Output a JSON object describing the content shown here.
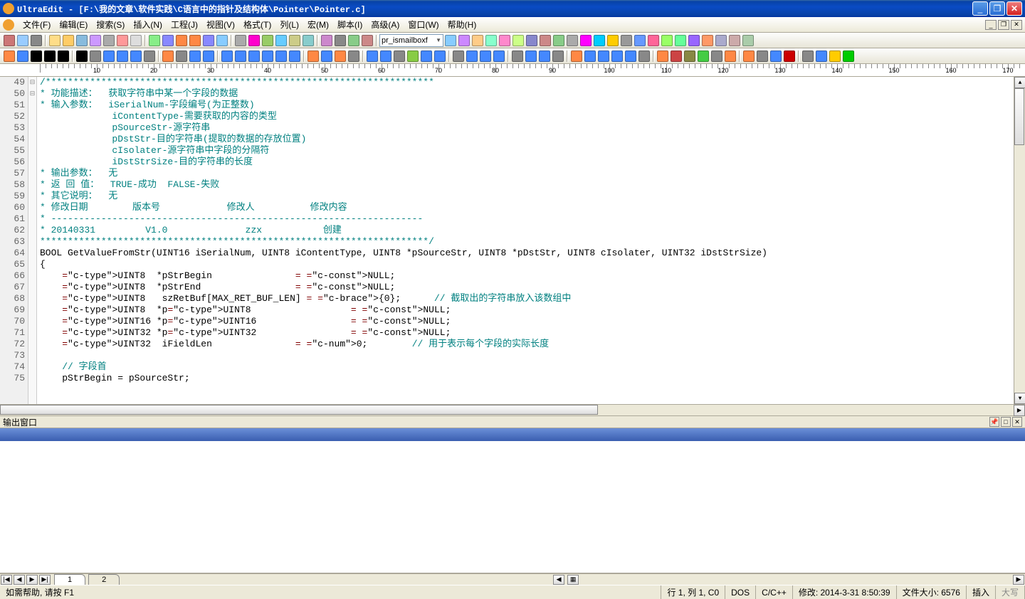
{
  "title": "UltraEdit - [F:\\我的文章\\软件实践\\C语言中的指针及结构体\\Pointer\\Pointer.c]",
  "menus": [
    "文件(F)",
    "编辑(E)",
    "搜索(S)",
    "插入(N)",
    "工程(J)",
    "视图(V)",
    "格式(T)",
    "列(L)",
    "宏(M)",
    "脚本(I)",
    "高级(A)",
    "窗口(W)",
    "帮助(H)"
  ],
  "toolbar_combo": "pr_ismailboxf",
  "ruler_marks": [
    10,
    20,
    30,
    40,
    50,
    60,
    70,
    80,
    90,
    100,
    110,
    120,
    130,
    140,
    150,
    160,
    170
  ],
  "gutter_start": 49,
  "code_lines": [
    {
      "t": "comment",
      "text": "/**********************************************************************"
    },
    {
      "t": "comment",
      "text": "* 功能描述：  获取字符串中某一个字段的数据"
    },
    {
      "t": "comment",
      "text": "* 输入参数：  iSerialNum-字段编号(为正整数)"
    },
    {
      "t": "comment",
      "text": "             iContentType-需要获取的内容的类型"
    },
    {
      "t": "comment",
      "text": "             pSourceStr-源字符串"
    },
    {
      "t": "comment",
      "text": "             pDstStr-目的字符串(提取的数据的存放位置)"
    },
    {
      "t": "comment",
      "text": "             cIsolater-源字符串中字段的分隔符"
    },
    {
      "t": "comment",
      "text": "             iDstStrSize-目的字符串的长度"
    },
    {
      "t": "comment",
      "text": "* 输出参数：  无"
    },
    {
      "t": "comment",
      "text": "* 返 回 值：  TRUE-成功  FALSE-失败"
    },
    {
      "t": "comment",
      "text": "* 其它说明：  无"
    },
    {
      "t": "comment",
      "text": "* 修改日期        版本号            修改人          修改内容"
    },
    {
      "t": "comment",
      "text": "* -------------------------------------------------------------------"
    },
    {
      "t": "comment",
      "text": "* 20140331         V1.0              zzx           创建"
    },
    {
      "t": "comment",
      "text": "**********************************************************************/"
    },
    {
      "t": "sig",
      "text": "BOOL GetValueFromStr(UINT16 iSerialNum, UINT8 iContentType, UINT8 *pSourceStr, UINT8 *pDstStr, UINT8 cIsolater, UINT32 iDstStrSize)"
    },
    {
      "t": "brace",
      "text": "{"
    },
    {
      "t": "decl",
      "text": "    UINT8  *pStrBegin               = NULL;"
    },
    {
      "t": "decl",
      "text": "    UINT8  *pStrEnd                 = NULL;"
    },
    {
      "t": "declc",
      "text": "    UINT8   szRetBuf[MAX_RET_BUF_LEN] = {0};",
      "cmt": "      // 截取出的字符串放入该数组中"
    },
    {
      "t": "decl",
      "text": "    UINT8  *pUINT8                  = NULL;"
    },
    {
      "t": "decl",
      "text": "    UINT16 *pUINT16                 = NULL;"
    },
    {
      "t": "decl",
      "text": "    UINT32 *pUINT32                 = NULL;"
    },
    {
      "t": "declc",
      "text": "    UINT32  iFieldLen               = 0;",
      "cmt": "        // 用于表示每个字段的实际长度"
    },
    {
      "t": "blank",
      "text": ""
    },
    {
      "t": "cmt",
      "text": "    // 字段首"
    },
    {
      "t": "stmt",
      "text": "    pStrBegin = pSourceStr;"
    }
  ],
  "output_title": "输出窗口",
  "doc_tabs": [
    "1",
    "2"
  ],
  "status": {
    "help": "如需帮助, 请按 F1",
    "pos": "行 1, 列 1, C0",
    "enc": "DOS",
    "lang": "C/C++",
    "mod": "修改: 2014-3-31 8:50:39",
    "size": "文件大小: 6576",
    "ins": "插入",
    "caps": "大写"
  }
}
